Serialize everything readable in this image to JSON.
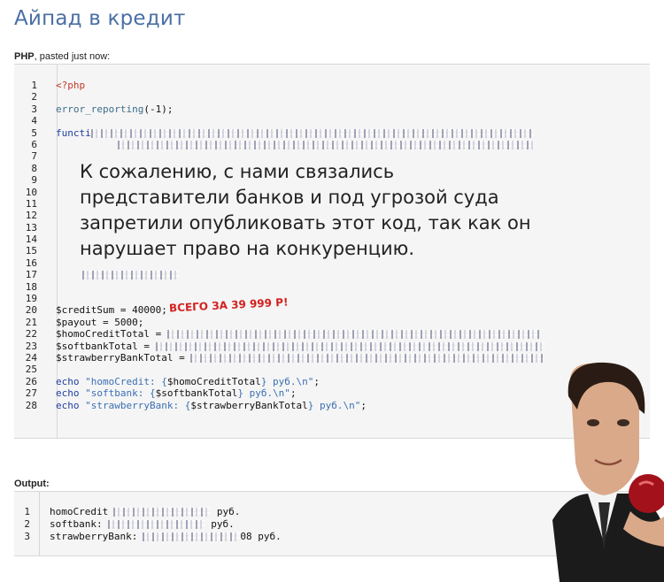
{
  "page": {
    "title": "Айпад в кредит"
  },
  "paste_caption": {
    "lang": "PHP",
    "suffix": ", pasted just now:"
  },
  "code": {
    "lines": [
      {
        "num": "1",
        "parts": [
          {
            "t": "<?php",
            "c": "kw-red"
          }
        ]
      },
      {
        "num": "2",
        "parts": []
      },
      {
        "num": "3",
        "parts": [
          {
            "t": "error_reporting",
            "c": "fn"
          },
          {
            "t": "(-1);",
            "c": "var"
          }
        ]
      },
      {
        "num": "4",
        "parts": []
      },
      {
        "num": "5",
        "parts": [
          {
            "t": "functi",
            "c": "kw-blue"
          },
          {
            "t": "",
            "c": "noise",
            "w": 500
          }
        ]
      },
      {
        "num": "6",
        "parts": [
          {
            "t": "",
            "c": "noise",
            "w": 470,
            "indent": 70
          }
        ]
      },
      {
        "num": "7",
        "parts": []
      },
      {
        "num": "8",
        "parts": []
      },
      {
        "num": "9",
        "parts": []
      },
      {
        "num": "10",
        "parts": []
      },
      {
        "num": "11",
        "parts": []
      },
      {
        "num": "12",
        "parts": []
      },
      {
        "num": "13",
        "parts": []
      },
      {
        "num": "14",
        "parts": []
      },
      {
        "num": "15",
        "parts": []
      },
      {
        "num": "16",
        "parts": []
      },
      {
        "num": "17",
        "parts": [
          {
            "t": "",
            "c": "noise",
            "w": 110,
            "indent": 30
          }
        ]
      },
      {
        "num": "18",
        "parts": []
      },
      {
        "num": "19",
        "parts": []
      },
      {
        "num": "20",
        "parts": [
          {
            "t": "$creditSum = ",
            "c": "var"
          },
          {
            "t": "40000",
            "c": "var"
          },
          {
            "t": ";",
            "c": "var"
          }
        ]
      },
      {
        "num": "21",
        "parts": [
          {
            "t": "$payout = 5000;",
            "c": "var"
          }
        ]
      },
      {
        "num": "22",
        "parts": [
          {
            "t": "$homoCreditTotal = ",
            "c": "var"
          },
          {
            "t": "",
            "c": "noise",
            "w": 420
          }
        ]
      },
      {
        "num": "23",
        "parts": [
          {
            "t": "$softbankTotal = ",
            "c": "var"
          },
          {
            "t": "",
            "c": "noise",
            "w": 440
          }
        ]
      },
      {
        "num": "24",
        "parts": [
          {
            "t": "$strawberryBankTotal = ",
            "c": "var"
          },
          {
            "t": "",
            "c": "noise",
            "w": 400
          }
        ]
      },
      {
        "num": "25",
        "parts": []
      },
      {
        "num": "26",
        "parts": [
          {
            "t": "echo ",
            "c": "kw-blue"
          },
          {
            "t": "\"homoCredit: {",
            "c": "str"
          },
          {
            "t": "$homoCreditTotal",
            "c": "var"
          },
          {
            "t": "} руб.\\n\"",
            "c": "str"
          },
          {
            "t": ";",
            "c": "var"
          }
        ]
      },
      {
        "num": "27",
        "parts": [
          {
            "t": "echo ",
            "c": "kw-blue"
          },
          {
            "t": "\"softbank: {",
            "c": "str"
          },
          {
            "t": "$softbankTotal",
            "c": "var"
          },
          {
            "t": "} руб.\\n\"",
            "c": "str"
          },
          {
            "t": ";",
            "c": "var"
          }
        ]
      },
      {
        "num": "28",
        "parts": [
          {
            "t": "echo ",
            "c": "kw-blue"
          },
          {
            "t": "\"strawberryBank: {",
            "c": "str"
          },
          {
            "t": "$strawberryBankTotal",
            "c": "var"
          },
          {
            "t": "} руб.\\n\"",
            "c": "str"
          },
          {
            "t": ";",
            "c": "var"
          }
        ]
      }
    ]
  },
  "overlay": {
    "message": "К сожалению, с нами связались представители банков и под угрозой суда запретили опубликовать этот код, так как он нарушает право на конкуренцию.",
    "price_note": "ВСЕГО ЗА 39 999 Р!"
  },
  "output": {
    "caption": "Output:",
    "lines": [
      {
        "num": "1",
        "label": "homoCredit",
        "value_suffix": " руб."
      },
      {
        "num": "2",
        "label": "softbank:",
        "value_suffix": " руб."
      },
      {
        "num": "3",
        "label": "strawberryBank:",
        "value_suffix": "08 руб."
      }
    ]
  },
  "colors": {
    "title": "#4a6fa5",
    "panel_bg": "#f5f5f5",
    "price_note": "#d42020",
    "keyword": "#1f3fa0",
    "string": "#3b6fb3"
  }
}
